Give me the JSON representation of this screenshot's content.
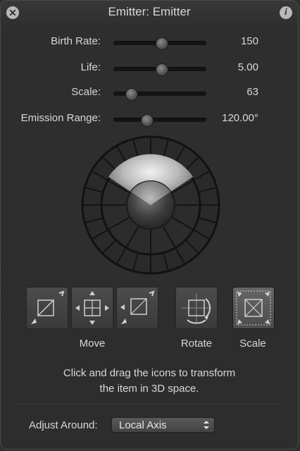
{
  "window": {
    "title": "Emitter: Emitter",
    "close_glyph": "✕",
    "info_glyph": "i"
  },
  "parameters": [
    {
      "label": "Birth Rate:",
      "value": "150",
      "level": 0.52
    },
    {
      "label": "Life:",
      "value": "5.00",
      "level": 0.52
    },
    {
      "label": "Scale:",
      "value": "63",
      "level": 0.2
    },
    {
      "label": "Emission Range:",
      "value": "120.00°",
      "level": 0.36
    }
  ],
  "emission_wheel": {
    "range_degrees": 120
  },
  "transform_tools": {
    "move_label": "Move",
    "rotate_label": "Rotate",
    "scale_label": "Scale",
    "icons": [
      "move-diagonal-icon",
      "move-pan-icon",
      "move-depth-icon",
      "rotate-icon",
      "scale-icon"
    ],
    "active_tool": "scale"
  },
  "hint": {
    "line1": "Click and drag the icons to transform",
    "line2": "the item in 3D space."
  },
  "adjust": {
    "label": "Adjust Around:",
    "value": "Local Axis"
  },
  "colors": {
    "background": "#2d2d2d",
    "text": "#d8d8d8",
    "track": "#141414"
  }
}
